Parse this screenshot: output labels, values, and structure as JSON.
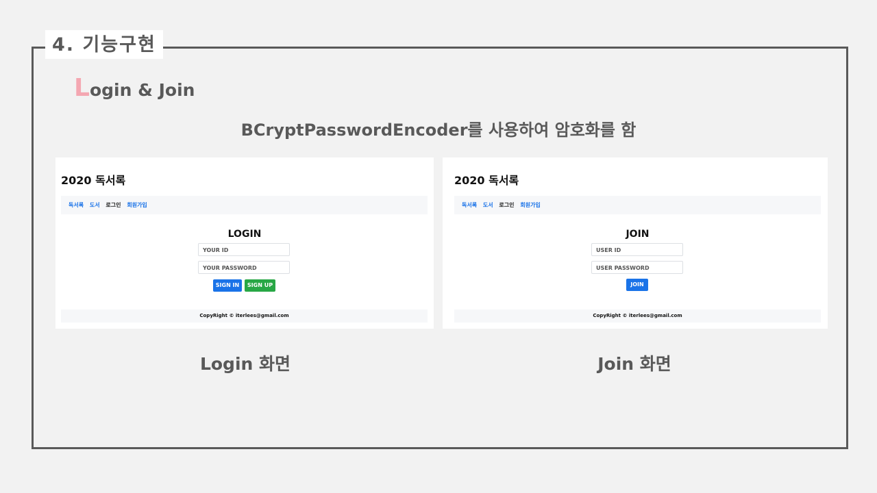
{
  "slide": {
    "section_label": "4. 기능구현",
    "subtitle_cap": "L",
    "subtitle_rest": "ogin & Join",
    "description": "BCryptPasswordEncoder를 사용하여 암호화를 함"
  },
  "login_screen": {
    "brand": "2020 독서록",
    "nav": [
      "독서록",
      "도서",
      "로그인",
      "회원가입"
    ],
    "title": "LOGIN",
    "id_placeholder": "YOUR ID",
    "password_placeholder": "YOUR PASSWORD",
    "signin_label": "SIGN IN",
    "signup_label": "SIGN UP",
    "footer": "CopyRight © iterlees@gmail.com",
    "caption": "Login 화면"
  },
  "join_screen": {
    "brand": "2020 독서록",
    "nav": [
      "독서록",
      "도서",
      "로그인",
      "회원가입"
    ],
    "title": "JOIN",
    "id_placeholder": "USER ID",
    "password_placeholder": "USER PASSWORD",
    "join_label": "JOIN",
    "footer": "CopyRight © iterlees@gmail.com",
    "caption": "Join 화면"
  },
  "colors": {
    "accent_pink": "#f4a7b1",
    "primary_blue": "#1a73e8",
    "success_green": "#28a745"
  }
}
